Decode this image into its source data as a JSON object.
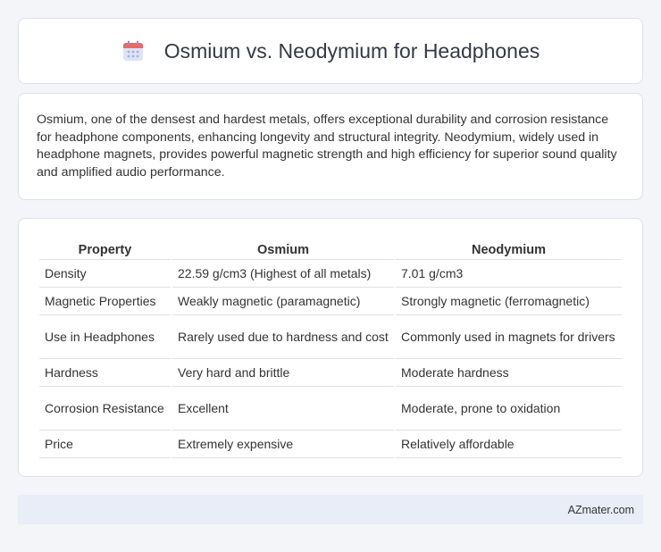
{
  "header": {
    "title": "Osmium vs. Neodymium for Headphones",
    "icon": "calendar-icon",
    "icon_colors": {
      "body": "#dfe3f5",
      "top": "#e86a6a",
      "dots": "#a6b1e1"
    }
  },
  "description": {
    "text": "Osmium, one of the densest and hardest metals, offers exceptional durability and corrosion resistance for headphone components, enhancing longevity and structural integrity. Neodymium, widely used in headphone magnets, provides powerful magnetic strength and high efficiency for superior sound quality and amplified audio performance."
  },
  "table": {
    "headers": [
      "Property",
      "Osmium",
      "Neodymium"
    ],
    "rows": [
      {
        "property": "Density",
        "osmium": "22.59 g/cm3 (Highest of all metals)",
        "neodymium": "7.01 g/cm3"
      },
      {
        "property": "Magnetic Properties",
        "osmium": "Weakly magnetic (paramagnetic)",
        "neodymium": "Strongly magnetic (ferromagnetic)"
      },
      {
        "property": "Use in Headphones",
        "osmium": "Rarely used due to hardness and cost",
        "neodymium": "Commonly used in magnets for drivers"
      },
      {
        "property": "Hardness",
        "osmium": "Very hard and brittle",
        "neodymium": "Moderate hardness"
      },
      {
        "property": "Corrosion Resistance",
        "osmium": "Excellent",
        "neodymium": "Moderate, prone to oxidation"
      },
      {
        "property": "Price",
        "osmium": "Extremely expensive",
        "neodymium": "Relatively affordable"
      }
    ]
  },
  "footer": {
    "text": "AZmater.com"
  }
}
